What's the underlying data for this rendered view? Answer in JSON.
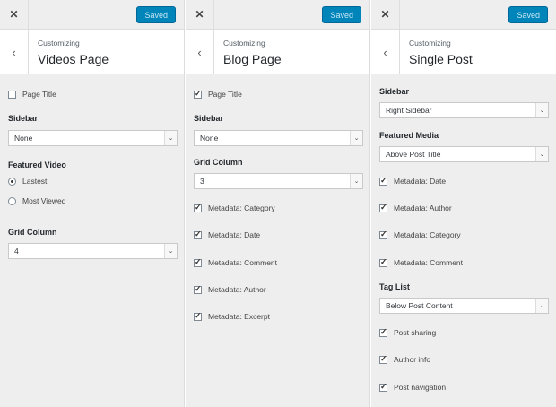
{
  "saved_label": "Saved",
  "close_icon_glyph": "✕",
  "back_icon_glyph": "‹",
  "chevron_glyph": "⌄",
  "colors": {
    "saved_bg": "#0085ba",
    "panel_bg": "#eeeeee"
  },
  "panels": [
    {
      "subtitle": "Customizing",
      "title": "Videos Page",
      "page_title": {
        "label": "Page Title",
        "checked": false
      },
      "sidebar": {
        "label": "Sidebar",
        "value": "None"
      },
      "featured_video": {
        "label": "Featured Video",
        "options": [
          "Lastest",
          "Most Viewed"
        ],
        "selected": "Lastest"
      },
      "grid_column": {
        "label": "Grid Column",
        "value": "4"
      }
    },
    {
      "subtitle": "Customizing",
      "title": "Blog Page",
      "page_title": {
        "label": "Page Title",
        "checked": true
      },
      "sidebar": {
        "label": "Sidebar",
        "value": "None"
      },
      "grid_column": {
        "label": "Grid Column",
        "value": "3"
      },
      "checkboxes": [
        {
          "label": "Metadata: Category",
          "checked": true
        },
        {
          "label": "Metadata: Date",
          "checked": true
        },
        {
          "label": "Metadata: Comment",
          "checked": true
        },
        {
          "label": "Metadata: Author",
          "checked": true
        },
        {
          "label": "Metadata: Excerpt",
          "checked": true
        }
      ]
    },
    {
      "subtitle": "Customizing",
      "title": "Single Post",
      "sidebar": {
        "label": "Sidebar",
        "value": "Right Sidebar"
      },
      "featured_media": {
        "label": "Featured Media",
        "value": "Above Post Title"
      },
      "metadata": [
        {
          "label": "Metadata: Date",
          "checked": true
        },
        {
          "label": "Metadata: Author",
          "checked": true
        },
        {
          "label": "Metadata: Category",
          "checked": true
        },
        {
          "label": "Metadata: Comment",
          "checked": true
        }
      ],
      "tag_list": {
        "label": "Tag List",
        "value": "Below Post Content"
      },
      "extras": [
        {
          "label": "Post sharing",
          "checked": true
        },
        {
          "label": "Author info",
          "checked": true
        },
        {
          "label": "Post navigation",
          "checked": true
        }
      ]
    }
  ]
}
